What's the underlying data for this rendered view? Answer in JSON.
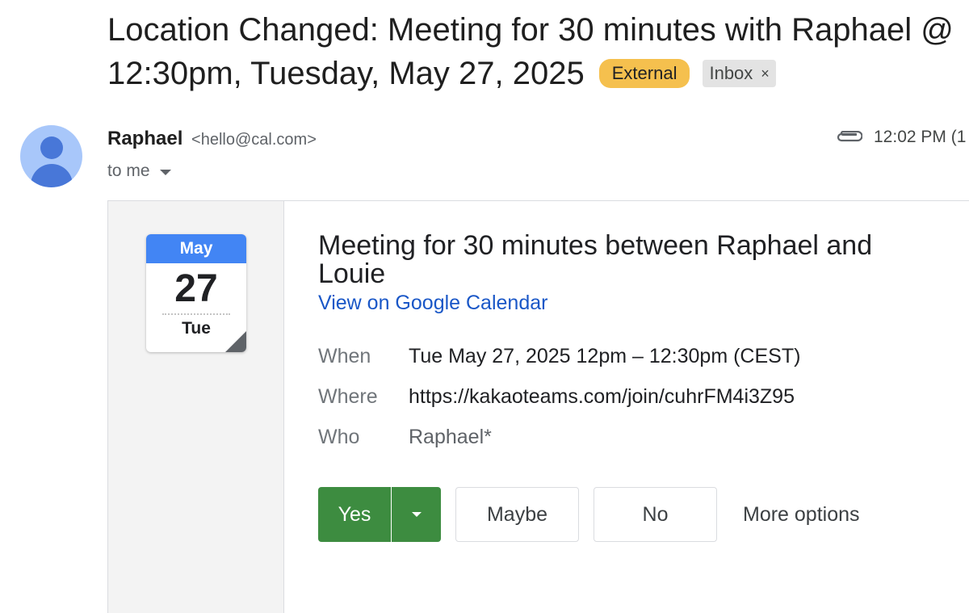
{
  "subject": {
    "line1": "Location Changed: Meeting for 30 minutes with Raphael @",
    "line2": "12:30pm, Tuesday, May 27, 2025",
    "labels": {
      "external": "External",
      "inbox": "Inbox",
      "inbox_remove": "×"
    }
  },
  "sender": {
    "name": "Raphael",
    "email": "<hello@cal.com>",
    "to": "to me",
    "time": "12:02 PM (1",
    "attachment_icon": "paperclip-icon",
    "avatar_icon": "person-icon"
  },
  "invite": {
    "calendar_icon": {
      "month": "May",
      "day": "27",
      "weekday": "Tue"
    },
    "title": "Meeting for 30 minutes between Raphael and Louie",
    "calendar_link": "View on Google Calendar",
    "details": {
      "when_label": "When",
      "when_value": "Tue May 27, 2025 12pm – 12:30pm (CEST)",
      "where_label": "Where",
      "where_value": "https://kakaoteams.com/join/cuhrFM4i3Z95",
      "who_label": "Who",
      "who_value": "Raphael*"
    },
    "rsvp": {
      "yes": "Yes",
      "maybe": "Maybe",
      "no": "No",
      "more": "More options"
    }
  },
  "colors": {
    "external_chip": "#f5c04e",
    "yes_button": "#3d8c40",
    "link": "#1a57c7",
    "calendar_header": "#4285f4",
    "avatar_bg": "#a8c7fa"
  }
}
